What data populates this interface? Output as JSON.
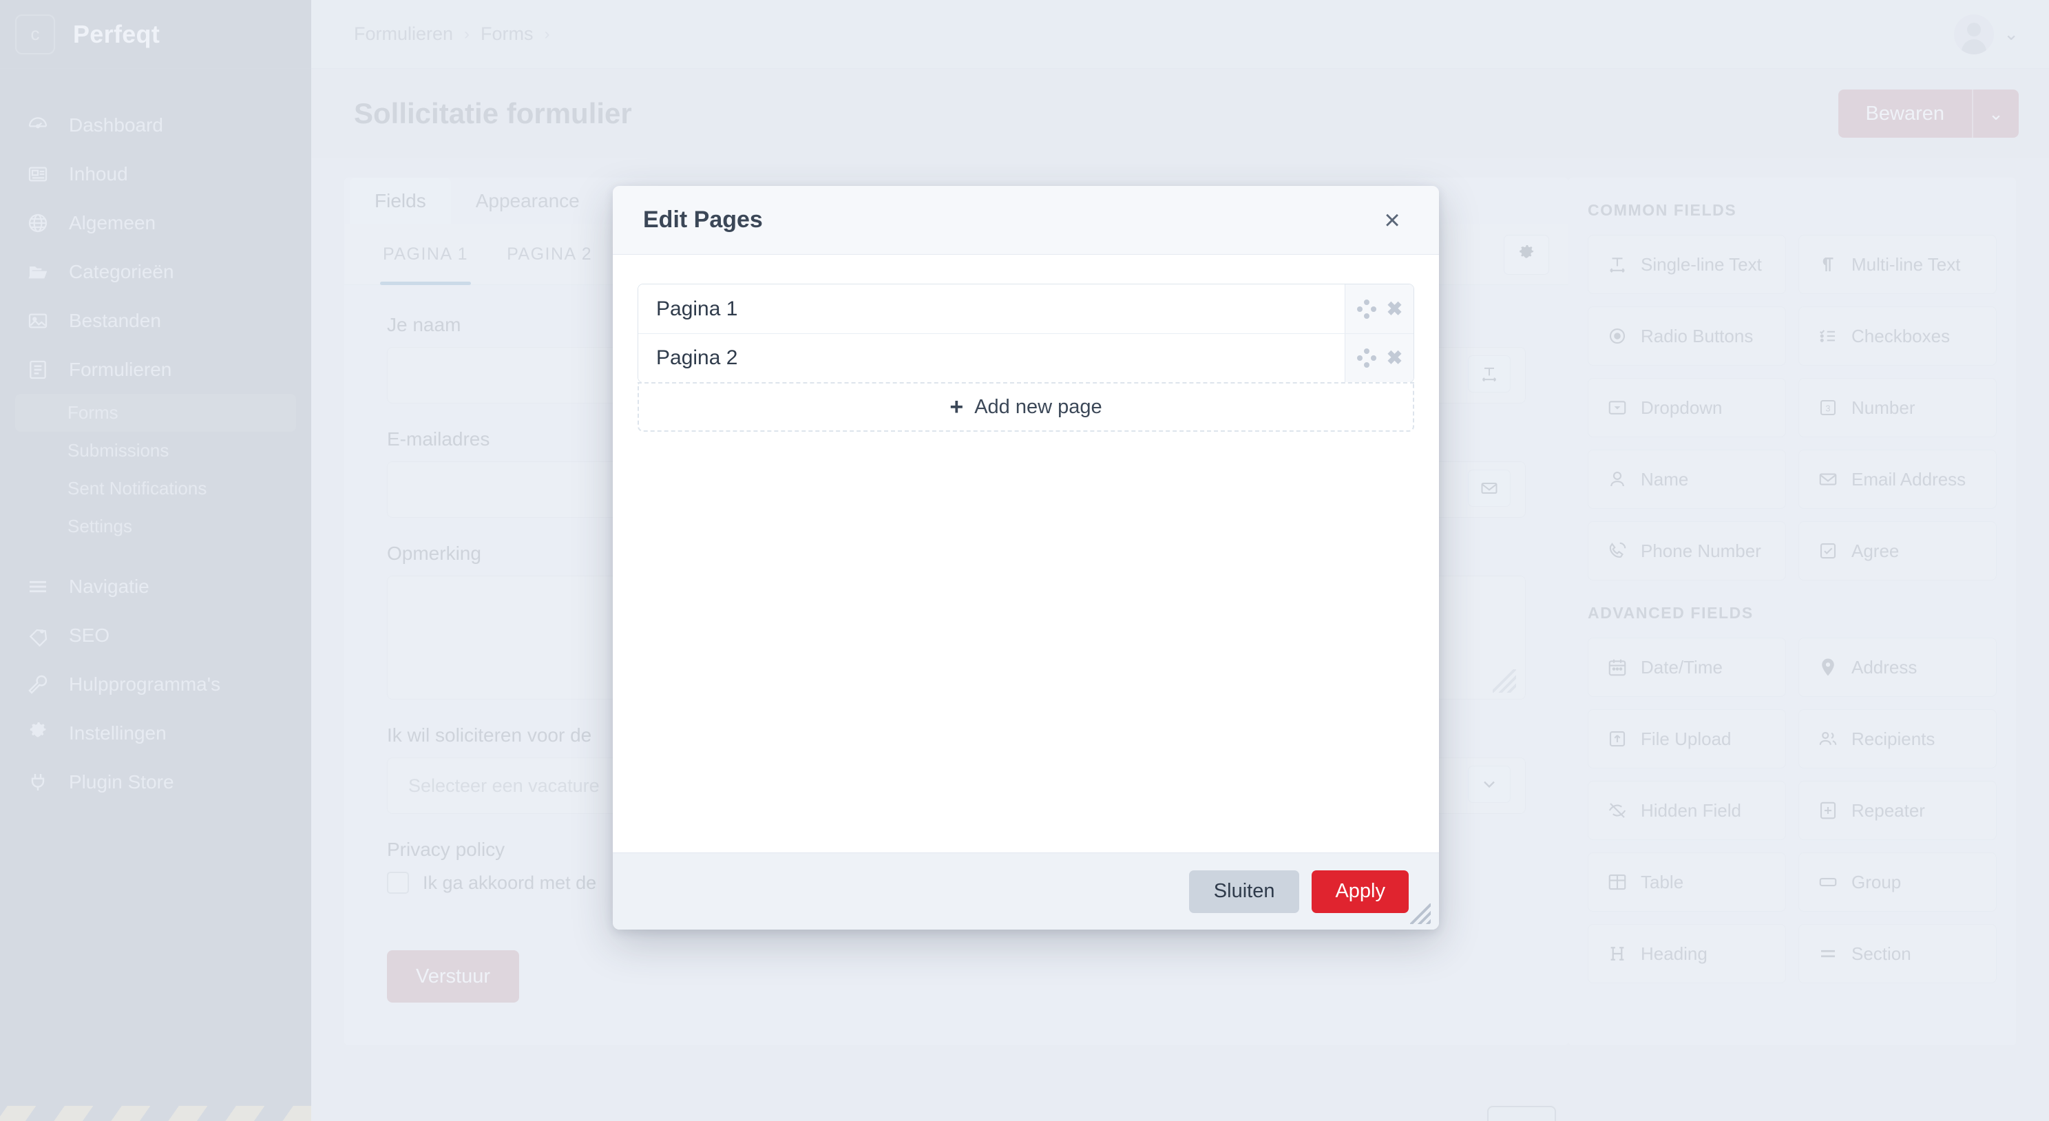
{
  "sidebar": {
    "brand_badge": "c",
    "brand_name": "Perfeqt",
    "items": [
      {
        "label": "Dashboard",
        "icon": "gauge-icon"
      },
      {
        "label": "Inhoud",
        "icon": "newspaper-icon"
      },
      {
        "label": "Algemeen",
        "icon": "globe-icon"
      },
      {
        "label": "Categorieën",
        "icon": "folder-icon"
      },
      {
        "label": "Bestanden",
        "icon": "image-icon"
      },
      {
        "label": "Formulieren",
        "icon": "form-icon"
      }
    ],
    "sub_items": [
      {
        "label": "Forms",
        "active": true
      },
      {
        "label": "Submissions",
        "active": false
      },
      {
        "label": "Sent Notifications",
        "active": false
      },
      {
        "label": "Settings",
        "active": false
      }
    ],
    "items_after": [
      {
        "label": "Navigatie",
        "icon": "menu-icon"
      },
      {
        "label": "SEO",
        "icon": "tag-icon"
      },
      {
        "label": "Hulpprogramma's",
        "icon": "wrench-icon"
      },
      {
        "label": "Instellingen",
        "icon": "gear-icon"
      },
      {
        "label": "Plugin Store",
        "icon": "plug-icon"
      }
    ]
  },
  "topbar": {
    "breadcrumb": [
      "Formulieren",
      "Forms"
    ],
    "separator": "›"
  },
  "page_header": {
    "title": "Sollicitatie formulier",
    "save_label": "Bewaren",
    "save_caret": "⌄"
  },
  "builder": {
    "tabs": [
      {
        "label": "Fields",
        "active": true
      },
      {
        "label": "Appearance",
        "active": false
      }
    ],
    "page_tabs": [
      {
        "label": "PAGINA 1",
        "active": true
      },
      {
        "label": "PAGINA 2",
        "active": false
      }
    ],
    "fields": [
      {
        "label": "Je naam",
        "value": "",
        "icon": "single-line-text-icon"
      },
      {
        "label": "E-mailadres",
        "value": "",
        "icon": "envelope-icon"
      },
      {
        "label": "Opmerking",
        "value": "",
        "icon": "textarea-icon"
      },
      {
        "label": "Ik wil soliciteren voor de",
        "value": "Selecteer een vacature",
        "icon": "chevron-down-icon"
      },
      {
        "label": "Privacy policy",
        "value": "",
        "icon": ""
      }
    ],
    "checkbox_label": "Ik ga akkoord met de",
    "submit_label": "Verstuur"
  },
  "palette": {
    "common_title": "COMMON FIELDS",
    "common_items": [
      {
        "label": "Single-line Text",
        "icon": "single-line-text-icon"
      },
      {
        "label": "Multi-line Text",
        "icon": "paragraph-icon"
      },
      {
        "label": "Radio Buttons",
        "icon": "radio-icon"
      },
      {
        "label": "Checkboxes",
        "icon": "checklist-icon"
      },
      {
        "label": "Dropdown",
        "icon": "dropdown-icon"
      },
      {
        "label": "Number",
        "icon": "number-icon"
      },
      {
        "label": "Name",
        "icon": "person-icon"
      },
      {
        "label": "Email Address",
        "icon": "envelope-icon"
      },
      {
        "label": "Phone Number",
        "icon": "phone-icon"
      },
      {
        "label": "Agree",
        "icon": "checkbox-icon"
      }
    ],
    "advanced_title": "ADVANCED FIELDS",
    "advanced_items": [
      {
        "label": "Date/Time",
        "icon": "calendar-icon"
      },
      {
        "label": "Address",
        "icon": "pin-icon"
      },
      {
        "label": "File Upload",
        "icon": "upload-icon"
      },
      {
        "label": "Recipients",
        "icon": "people-icon"
      },
      {
        "label": "Hidden Field",
        "icon": "eye-off-icon"
      },
      {
        "label": "Repeater",
        "icon": "plus-box-icon"
      },
      {
        "label": "Table",
        "icon": "table-icon"
      },
      {
        "label": "Group",
        "icon": "group-icon"
      },
      {
        "label": "Heading",
        "icon": "heading-icon"
      },
      {
        "label": "Section",
        "icon": "section-icon"
      }
    ]
  },
  "modal": {
    "title": "Edit Pages",
    "close_glyph": "×",
    "rows": [
      {
        "name": "Pagina 1"
      },
      {
        "name": "Pagina 2"
      }
    ],
    "add_label": "Add new page",
    "add_plus": "+",
    "row_delete_glyph": "✖",
    "close_button": "Sluiten",
    "apply_button": "Apply"
  },
  "colors": {
    "sidebar_bg": "#a7b0bd",
    "accent_blue": "#74b3ea",
    "apply_red": "#e0242f",
    "save_pink": "#e39aa4",
    "page_bg": "#e8edf5"
  }
}
